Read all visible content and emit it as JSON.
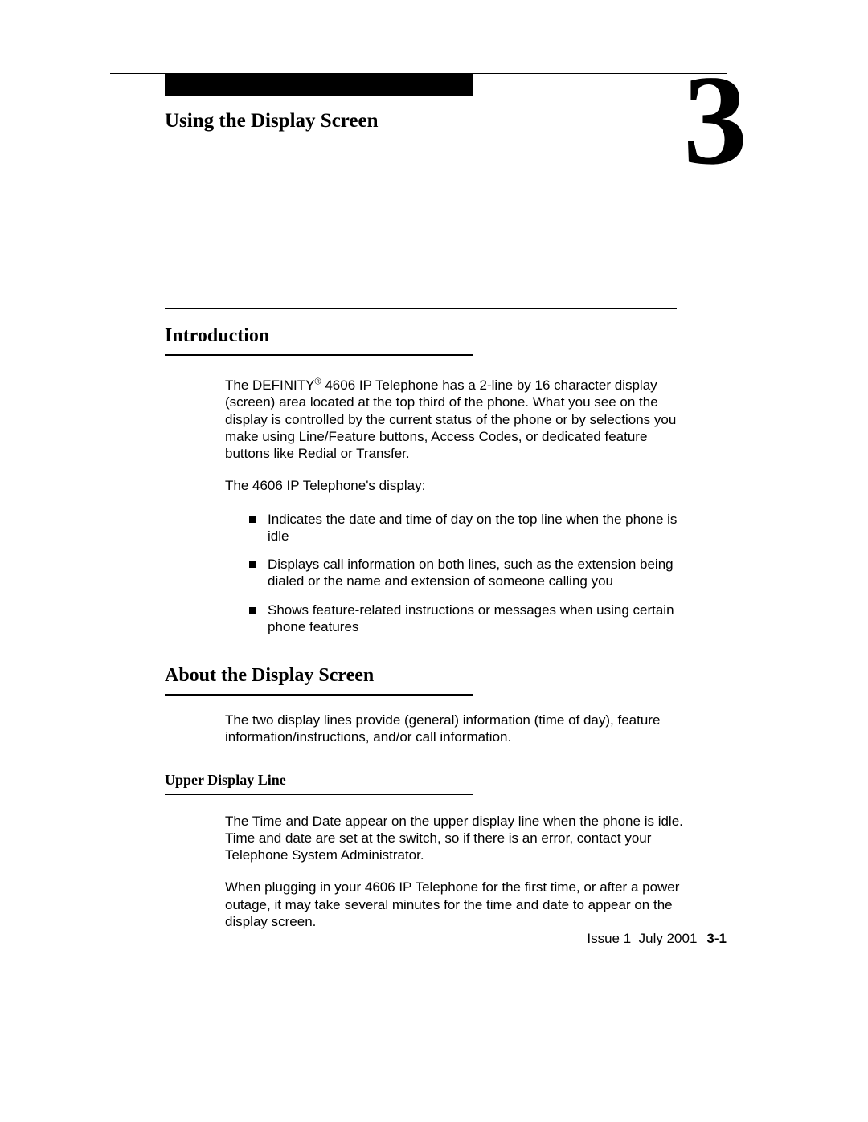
{
  "chapter": {
    "title": "Using the Display Screen",
    "number": "3"
  },
  "sections": {
    "introduction": {
      "heading": "Introduction",
      "p1_prefix": "The DEFINITY",
      "p1_reg": "®",
      "p1_suffix": " 4606 IP Telephone has a 2-line by 16 character display (screen) area located at the top third of the phone. What you see on the display is controlled by the current status of the phone or by selections you make using Line/Feature buttons, Access Codes, or dedicated feature buttons like Redial or Transfer.",
      "p2": "The 4606 IP Telephone's display:",
      "bullets": [
        "Indicates the date and time of day on the top line when the phone is idle",
        "Displays call information on both lines, such as the extension being dialed or the name and extension of someone calling you",
        "Shows feature-related instructions or messages when using certain phone features"
      ]
    },
    "about": {
      "heading": "About the Display Screen",
      "p1": "The two display lines provide (general) information (time of day), feature information/instructions, and/or call information.",
      "upper": {
        "heading": "Upper Display Line",
        "p1": "The Time and Date appear on the upper display line when the phone is idle. Time and date are set at the switch, so if there is an error, contact your Telephone System Administrator.",
        "p2": "When plugging in your 4606 IP Telephone for the first time, or after a power outage, it may take several minutes for the time and date to appear on the display screen."
      }
    }
  },
  "footer": {
    "issue_label": "Issue 1",
    "date": "July 2001",
    "page": "3-1"
  }
}
